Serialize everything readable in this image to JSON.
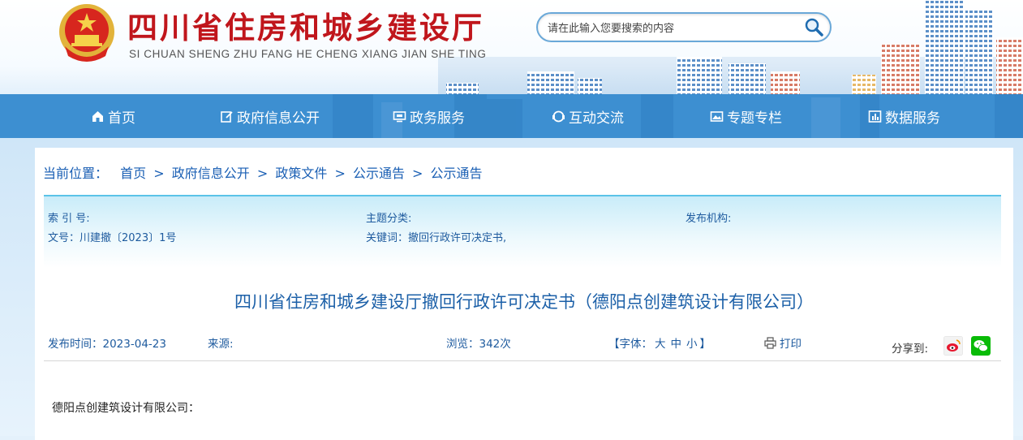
{
  "header": {
    "title": "四川省住房和城乡建设厅",
    "subtitle": "SI CHUAN SHENG ZHU FANG HE CHENG XIANG JIAN SHE TING",
    "search_placeholder": "请在此输入您要搜索的内容"
  },
  "nav": {
    "items": [
      {
        "label": "首页",
        "icon": "home-icon"
      },
      {
        "label": "政府信息公开",
        "icon": "edit-icon"
      },
      {
        "label": "政务服务",
        "icon": "monitor-icon"
      },
      {
        "label": "互动交流",
        "icon": "chat-icon"
      },
      {
        "label": "专题专栏",
        "icon": "picture-icon"
      },
      {
        "label": "数据服务",
        "icon": "chart-icon"
      }
    ]
  },
  "breadcrumb": {
    "label": "当前位置：",
    "items": [
      "首页",
      "政府信息公开",
      "政策文件",
      "公示通告",
      "公示通告"
    ],
    "separator": ">"
  },
  "meta": {
    "index_label": "索 引 号:",
    "topic_label": "主题分类:",
    "issuer_label": "发布机构:",
    "docno": "文号：川建撤〔2023〕1号",
    "keywords": "关键词：撤回行政许可决定书,"
  },
  "document": {
    "title": "四川省住房和城乡建设厅撤回行政许可决定书（德阳点创建筑设计有限公司）",
    "publish_time": "发布时间：2023-04-23",
    "source": "来源:",
    "views": "浏览：342次",
    "font_label_open": "【字体：",
    "font_sizes": [
      "大",
      "中",
      "小"
    ],
    "font_label_close": "】",
    "print": "打印",
    "share": "分享到:",
    "greeting": "德阳点创建筑设计有限公司："
  },
  "colors": {
    "brand_red": "#c0161c",
    "nav_blue": "#3d8fd1",
    "link_blue": "#1a5fb4",
    "meta_border": "#5bc3e8",
    "weibo": "#e6162d",
    "wechat": "#09bb07"
  }
}
